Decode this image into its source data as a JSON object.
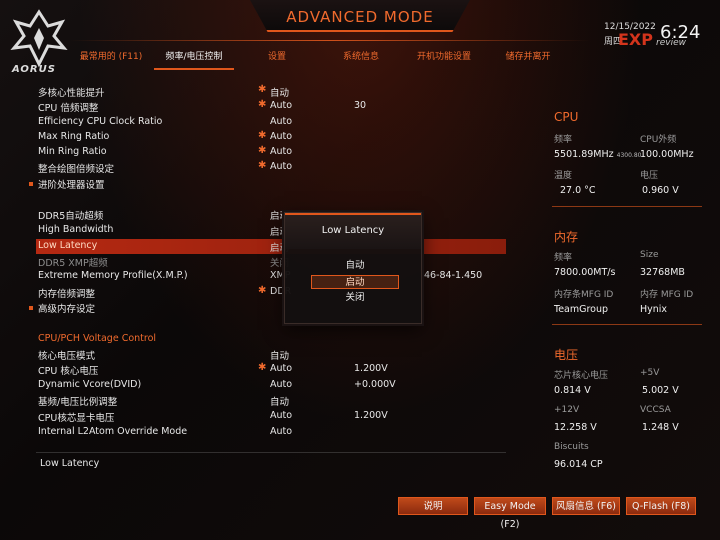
{
  "header": {
    "title": "ADVANCED MODE",
    "logo_text": "AORUS",
    "date": "12/15/2022",
    "weekday": "周四",
    "time": "6:24",
    "watermark": "EXP",
    "watermark_sub": "review"
  },
  "tabs": [
    {
      "label": "最常用的 (F11)",
      "active": false
    },
    {
      "label": "频率/电压控制",
      "active": true
    },
    {
      "label": "设置",
      "active": false
    },
    {
      "label": "系统信息",
      "active": false
    },
    {
      "label": "开机功能设置",
      "active": false
    },
    {
      "label": "储存并离开",
      "active": false
    }
  ],
  "settings": {
    "r1": {
      "label": "多核心性能提升",
      "value": "自动",
      "starred": true
    },
    "r2": {
      "label": "CPU 倍频调整",
      "value": "Auto",
      "value2": "30",
      "starred": true
    },
    "r3": {
      "label": "Efficiency CPU Clock Ratio",
      "value": "Auto"
    },
    "r4": {
      "label": "Max Ring Ratio",
      "value": "Auto",
      "starred": true
    },
    "r5": {
      "label": "Min Ring Ratio",
      "value": "Auto",
      "starred": true
    },
    "r6": {
      "label": "整合绘图倍频设定",
      "value": "Auto",
      "starred": true
    },
    "r7": {
      "label": "进阶处理器设置"
    },
    "r8": {
      "label": "DDR5自动超频",
      "value": "启动"
    },
    "r9": {
      "label": "High Bandwidth",
      "value": "启动"
    },
    "r10": {
      "label": "Low Latency",
      "value": "启动"
    },
    "r11": {
      "label": "DDR5 XMP超频",
      "value": "关闭"
    },
    "r12": {
      "label": "Extreme Memory Profile(X.M.P.)",
      "value": "XMP",
      "value2": "46-84-1.450"
    },
    "r13": {
      "label": "内存倍频调整",
      "value": "DDR",
      "starred": true
    },
    "r14": {
      "label": "高级内存设定"
    },
    "voltage_section": "CPU/PCH Voltage Control",
    "v1": {
      "label": "核心电压模式",
      "value": "自动"
    },
    "v2": {
      "label": "CPU 核心电压",
      "value": "Auto",
      "value2": "1.200V",
      "starred": true
    },
    "v3": {
      "label": "Dynamic Vcore(DVID)",
      "value": "Auto",
      "value2": "+0.000V"
    },
    "v4": {
      "label": "基频/电压比例调整",
      "value": "自动"
    },
    "v5": {
      "label": "CPU核芯显卡电压",
      "value": "Auto",
      "value2": "1.200V"
    },
    "v6": {
      "label": "Internal L2Atom Override Mode",
      "value": "Auto"
    }
  },
  "description": "Low Latency",
  "popup": {
    "title": "Low Latency",
    "options": [
      "自动",
      "启动",
      "关闭"
    ],
    "selected": "启动"
  },
  "cpu": {
    "title": "CPU",
    "freq_label": "频率",
    "freq": "5501.89MHz",
    "freq_sub": "4300.80",
    "bclk_label": "CPU外频",
    "bclk": "100.00MHz",
    "temp_label": "温度",
    "temp": "27.0 °C",
    "volt_label": "电压",
    "volt": "0.960 V"
  },
  "memory": {
    "title": "内存",
    "freq_label": "频率",
    "freq": "7800.00MT/s",
    "size_label": "Size",
    "size": "32768MB",
    "mfg1_label": "内存条MFG ID",
    "mfg1": "TeamGroup",
    "mfg2_label": "内存 MFG ID",
    "mfg2": "Hynix"
  },
  "voltage": {
    "title": "电压",
    "vcore_label": "芯片核心电压",
    "vcore": "0.814 V",
    "p5_label": "+5V",
    "p5": "5.002 V",
    "p12_label": "+12V",
    "p12": "12.258 V",
    "vccsa_label": "VCCSA",
    "vccsa": "1.248 V",
    "biscuits_label": "Biscuits",
    "biscuits": "96.014 CP"
  },
  "buttons": {
    "help": "说明",
    "easy": "Easy Mode (F2)",
    "fan": "风扇信息 (F6)",
    "qflash": "Q-Flash (F8)"
  },
  "colors": {
    "accent": "#e0571c",
    "highlight": "#b52912",
    "bg": "#0b0808"
  }
}
